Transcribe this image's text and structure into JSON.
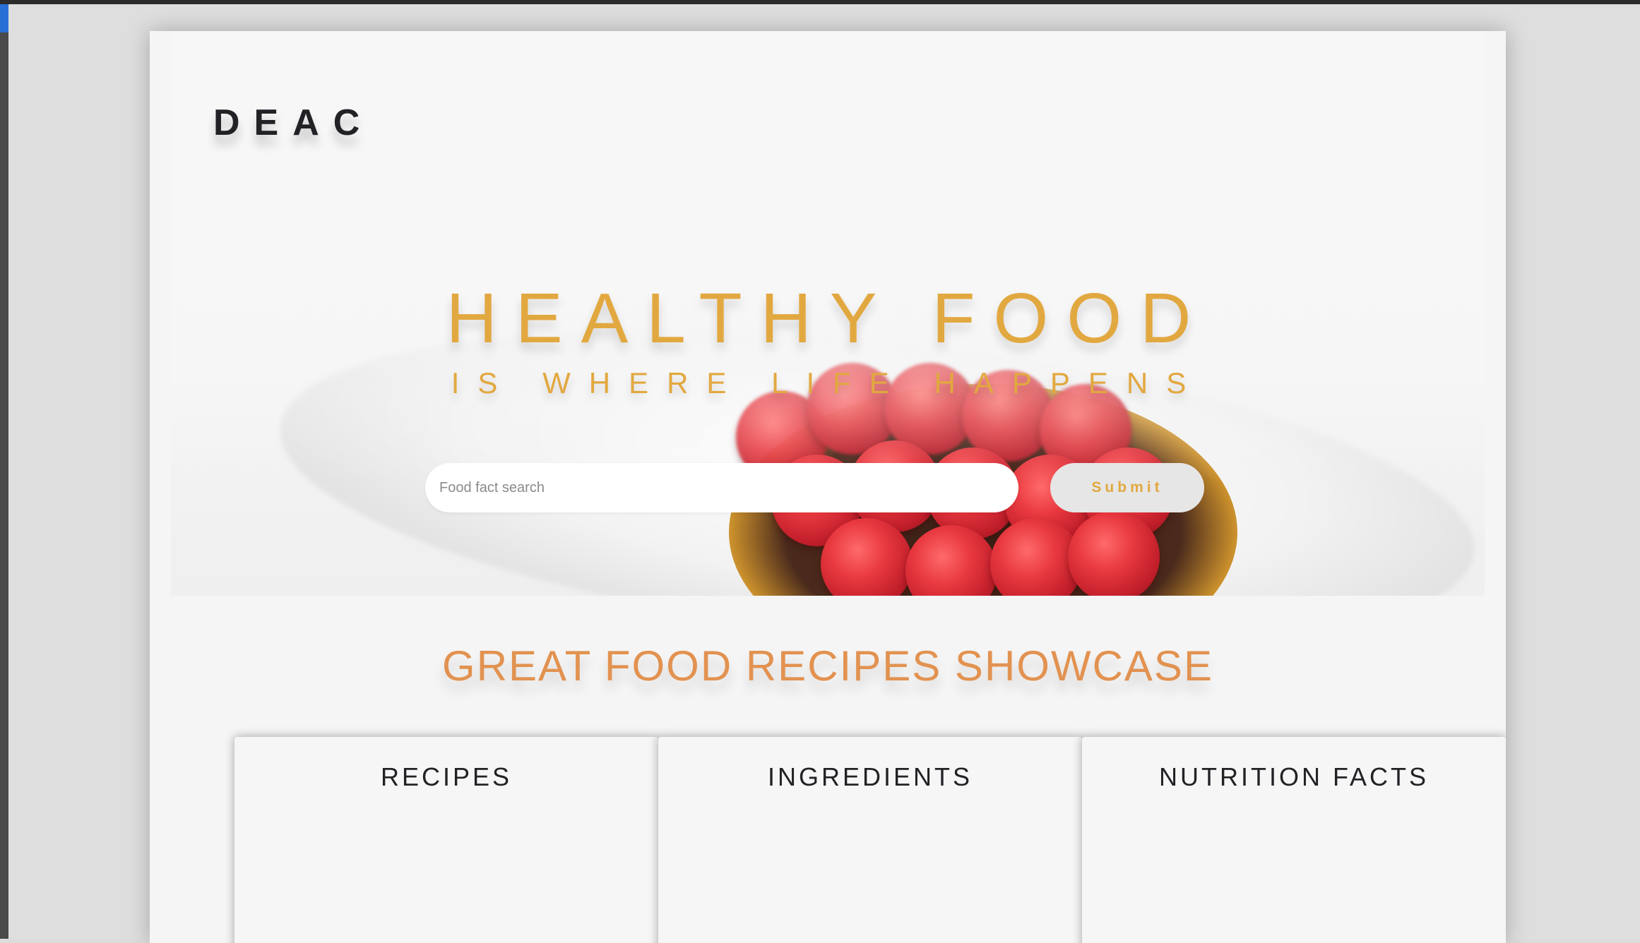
{
  "site": {
    "logo": "DEAC"
  },
  "hero": {
    "headline": "HEALTHY FOOD",
    "subline": "IS WHERE LIFE HAPPENS",
    "search": {
      "placeholder": "Food fact search",
      "submit_label": "Submit"
    }
  },
  "showcase": {
    "title": "GREAT FOOD RECIPES SHOWCASE",
    "cards": [
      {
        "label": "RECIPES"
      },
      {
        "label": "INGREDIENTS"
      },
      {
        "label": "NUTRITION FACTS"
      }
    ]
  },
  "colors": {
    "accent_gold": "#e2a840",
    "accent_orange": "#e29250",
    "text_dark": "#222226",
    "page_bg": "#f5f5f5"
  },
  "icons": [
    "raspberry-tart-image"
  ]
}
